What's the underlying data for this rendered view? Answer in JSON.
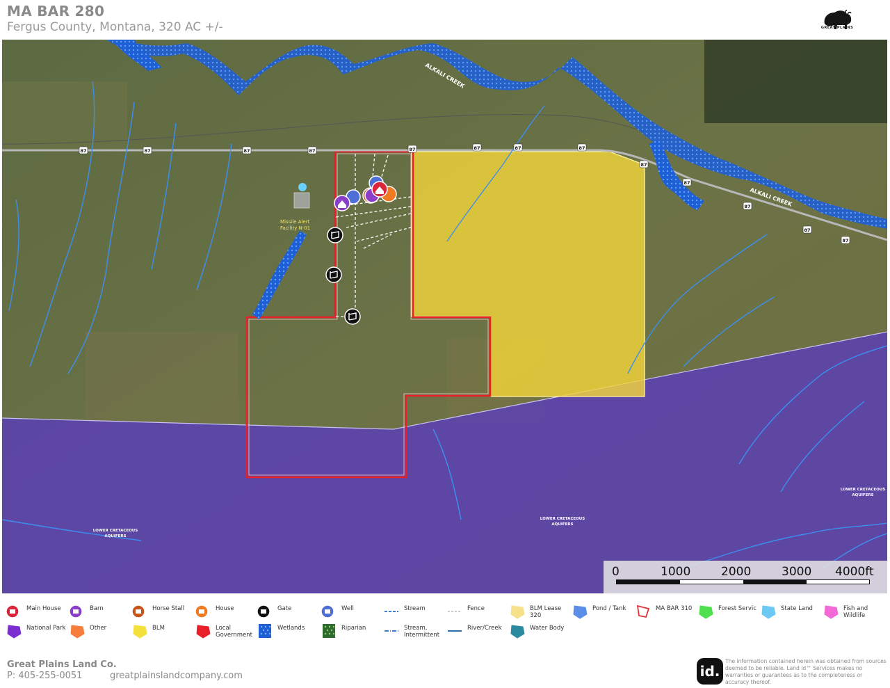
{
  "header": {
    "title": "MA BAR 280",
    "subtitle": "Fergus County, Montana, 320 AC +/-",
    "logo_text": "GREAT PLAINS"
  },
  "map": {
    "labels": {
      "creek_north": "ALKALI CREEK",
      "creek_east": "ALKALI CREEK",
      "facility": [
        "Missile Alert",
        "Facility N-01"
      ],
      "aquifer_west": [
        "LOWER CRETACEOUS",
        "AQUIFERS"
      ],
      "aquifer_center": [
        "LOWER CRETACEOUS",
        "AQUIFERS"
      ],
      "aquifer_east": [
        "LOWER CRETACEOUS",
        "AQUIFERS"
      ]
    },
    "highway_shield": "87",
    "colors": {
      "parcel_outline": "#e8202a",
      "blm_lease_fill": "#f2d43a",
      "national_park_fill": "#5a3bbf",
      "water": "#2a6fdb",
      "stream": "#2a7de1"
    },
    "icons": [
      "gate-icon",
      "barn-icon",
      "well-icon",
      "house-icon",
      "main-house-icon",
      "horse-stall-icon"
    ]
  },
  "scale": {
    "labels": [
      "0",
      "1000",
      "2000",
      "3000",
      "4000ft"
    ]
  },
  "legend": [
    {
      "label": "Main House",
      "icon": "main-house-icon",
      "color": "#d9263a"
    },
    {
      "label": "Barn",
      "icon": "barn-icon",
      "color": "#8b3fc9"
    },
    {
      "label": "Horse Stall",
      "icon": "horse-stall-icon",
      "color": "#c8561b"
    },
    {
      "label": "House",
      "icon": "house-icon",
      "color": "#ef7a22"
    },
    {
      "label": "Gate",
      "icon": "gate-icon",
      "color": "#111111"
    },
    {
      "label": "Well",
      "icon": "well-icon",
      "color": "#4f6fd6"
    },
    {
      "label": "Stream",
      "icon": "stream-line-icon",
      "color": "#3c7fd6"
    },
    {
      "label": "Fence",
      "icon": "fence-line-icon",
      "color": "#cccccc"
    },
    {
      "label": "BLM Lease 320",
      "icon": "blm-lease-icon",
      "color": "#f6e08a"
    },
    {
      "label": "Pond / Tank",
      "icon": "pond-icon",
      "color": "#5b8ee6"
    },
    {
      "label": "MA BAR 310",
      "icon": "parcel-outline-icon",
      "color": "#e0343a"
    },
    {
      "label": "Forest Servic",
      "icon": "forest-service-icon",
      "color": "#4ee04e"
    },
    {
      "label": "State Land",
      "icon": "state-land-icon",
      "color": "#6cc8f4"
    },
    {
      "label": "Fish and Wildlife",
      "icon": "fish-wildlife-icon",
      "color": "#f26ad6"
    },
    {
      "label": "National Park",
      "icon": "national-park-icon",
      "color": "#7b2fd1"
    },
    {
      "label": "Other",
      "icon": "other-icon",
      "color": "#f57e3a"
    },
    {
      "label": "BLM",
      "icon": "blm-icon",
      "color": "#f4e03a"
    },
    {
      "label": "Local Government",
      "icon": "local-government-icon",
      "color": "#e8202a"
    },
    {
      "label": "Wetlands",
      "icon": "wetlands-icon",
      "color": "#2a7be2"
    },
    {
      "label": "Riparian",
      "icon": "riparian-icon",
      "color": "#3a8a3a"
    },
    {
      "label": "Stream, Intermittent",
      "icon": "stream-intermittent-icon",
      "color": "#3c7fd6"
    },
    {
      "label": "River/Creek",
      "icon": "river-creek-icon",
      "color": "#2a6fb0"
    },
    {
      "label": "Water Body",
      "icon": "water-body-icon",
      "color": "#2a8aa0"
    }
  ],
  "footer": {
    "company": "Great Plains Land Co.",
    "phone": "P: 405-255-0051",
    "website": "greatplainslandcompany.com",
    "landid_logo": "id.",
    "disclaimer": "The information contained herein was obtained from sources deemed to be reliable. Land id™ Services makes no warranties or guarantees as to the completeness or accuracy thereof."
  }
}
